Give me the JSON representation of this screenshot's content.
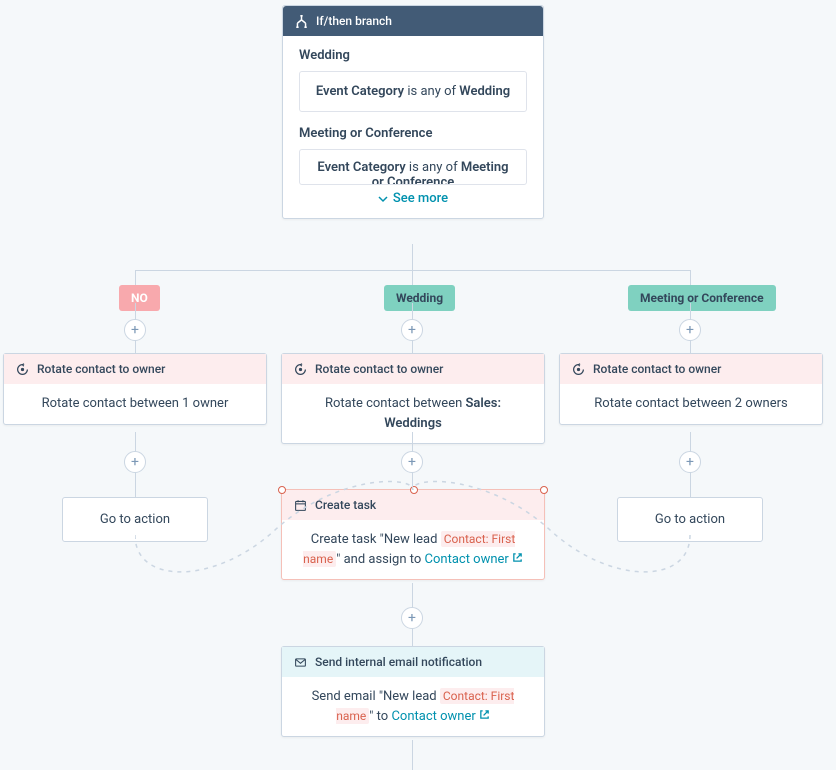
{
  "branch": {
    "title": "If/then branch",
    "groups": [
      {
        "title": "Wedding",
        "field": "Event Category",
        "op": " is any of ",
        "value": "Wedding"
      },
      {
        "title": "Meeting or Conference",
        "field": "Event Category",
        "op": " is any of ",
        "value": "Meeting or Conference"
      }
    ],
    "see_more": "See more"
  },
  "badges": {
    "no": "NO",
    "wedding": "Wedding",
    "meeting": "Meeting or Conference"
  },
  "rotate": {
    "title": "Rotate contact to owner",
    "left_body": "Rotate contact between 1 owner",
    "center_prefix": "Rotate contact between ",
    "center_value": "Sales: Weddings",
    "right_body": "Rotate contact between 2 owners"
  },
  "goto_label": "Go to action",
  "task": {
    "title": "Create task",
    "prefix": "Create task ",
    "quote_open": "\"",
    "lead_text": "New lead ",
    "token": "Contact: First name",
    "quote_close": "\"",
    "assign_prefix": " and assign to ",
    "owner": "Contact owner"
  },
  "email": {
    "title": "Send internal email notification",
    "prefix": "Send email ",
    "quote_open": "\"",
    "lead_text": "New lead ",
    "token": "Contact: First name",
    "quote_close": "\"",
    "to": " to ",
    "owner": "Contact owner"
  }
}
